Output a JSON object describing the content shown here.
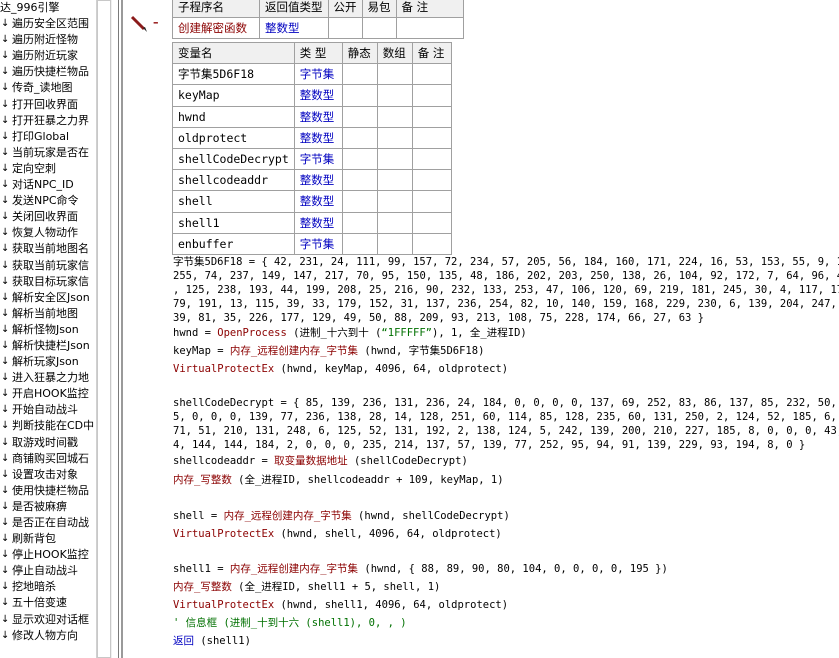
{
  "left_list": {
    "first": "达_996引擎",
    "items": [
      "遍历安全区范围",
      "遍历附近怪物",
      "遍历附近玩家",
      "遍历快捷栏物品",
      "传奇_读地图",
      "打开回收界面",
      "打开狂暴之力界",
      "打印Global",
      "当前玩家是否在",
      "定向空刺",
      "对话NPC_ID",
      "发送NPC命令",
      "关闭回收界面",
      "恢复人物动作",
      "获取当前地图名",
      "获取当前玩家信",
      "获取目标玩家信",
      "解析安全区Json",
      "解析当前地图",
      "解析怪物Json",
      "解析快捷栏Json",
      "解析玩家Json",
      "进入狂暴之力地",
      "开启HOOK监控",
      "开始自动战斗",
      "判断技能在CD中",
      "取游戏时间戳",
      "商铺购买回城石",
      "设置攻击对象",
      "使用快捷栏物品",
      "是否被麻痹",
      "是否正在自动战",
      "刷新背包",
      "停止HOOK监控",
      "停止自动战斗",
      "挖地暗杀",
      "五十倍变速",
      "显示欢迎对话框",
      "修改人物方向"
    ]
  },
  "sub_table": {
    "headers": [
      "子程序名",
      "返回值类型",
      "公开",
      "易包",
      "备 注"
    ],
    "row": [
      "创建解密函数",
      "整数型",
      "",
      "",
      ""
    ]
  },
  "var_table": {
    "headers": [
      "变量名",
      "类 型",
      "静态",
      "数组",
      "备 注"
    ],
    "rows": [
      {
        "name": "字节集5D6F18",
        "type": "字节集"
      },
      {
        "name": "keyMap",
        "type": "整数型"
      },
      {
        "name": "hwnd",
        "type": "整数型"
      },
      {
        "name": "oldprotect",
        "type": "整数型"
      },
      {
        "name": "shellCodeDecrypt",
        "type": "字节集"
      },
      {
        "name": "shellcodeaddr",
        "type": "整数型"
      },
      {
        "name": "shell",
        "type": "整数型"
      },
      {
        "name": "shell1",
        "type": "整数型"
      },
      {
        "name": "enbuffer",
        "type": "字节集"
      }
    ]
  },
  "code": {
    "l1": "字节集5D6F18 = { 42, 231, 24, 111, 99, 157, 72, 234, 57, 205, 56, 184, 160, 171, 224, 16, 53, 153, 55, 9, 192,",
    "l2": " 255, 74, 237, 149, 147, 217, 70, 95, 150, 135, 48, 186, 202, 203, 250, 138, 26, 104, 92, 172, 7, 64, 96, 41, 1",
    "l3": ", 125, 238, 193, 44, 199, 208, 25, 216, 90, 232, 133, 253, 47, 106, 120, 69, 219, 181, 245, 30, 4, 117, 176, 12",
    "l4": "79, 191, 13, 115, 39, 33, 179, 152, 31, 137, 236, 254, 82, 10, 140, 159, 168, 229, 230, 6, 139, 204, 247, 94, 2",
    "l5": "39, 81, 35, 226, 177, 129, 49, 50, 88, 209, 93, 213, 108, 75, 228, 174, 66, 27, 63 }",
    "hwnd_lhs": "hwnd = ",
    "hwnd_fn": "OpenProcess",
    "hwnd_mid": " (进制_十六到十 (",
    "hwnd_str": "“1FFFFF”",
    "hwnd_end": "), 1, 全_进程ID)",
    "keymap_lhs": "keyMap = ",
    "keymap_fn": "内存_远程创建内存_字节集",
    "keymap_args": " (hwnd, 字节集5D6F18)",
    "vpe1_fn": "VirtualProtectEx",
    "vpe1_args": " (hwnd, keyMap, 4096, 64, oldprotect)",
    "d1": "shellCodeDecrypt = { 85, 139, 236, 131, 236, 24, 184, 0, 0, 0, 0, 137, 69, 252, 83, 86, 137, 85, 232, 50, 255,",
    "d2": "5, 0, 0, 0, 139, 77, 236, 138, 28, 14, 128, 251, 60, 114, 85, 128, 235, 60, 131, 250, 2, 124, 52, 185, 6, 0, 0,",
    "d3": "71, 51, 210, 131, 248, 6, 125, 52, 131, 192, 2, 138, 124, 5, 242, 139, 200, 210, 227, 185, 8, 0, 0, 0, 43, 200,",
    "d4": "4, 144, 144, 184, 2, 0, 0, 0, 235, 214, 137, 57, 139, 77, 252, 95, 94, 91, 139, 229, 93, 194, 8, 0 }",
    "sca_lhs": "shellcodeaddr = ",
    "sca_fn": "取变量数据地址",
    "sca_args": " (shellCodeDecrypt)",
    "wi1_fn": "内存_写整数",
    "wi1_args": " (全_进程ID, shellcodeaddr + 109, keyMap, 1)",
    "shell_lhs": "shell = ",
    "shell_fn": "内存_远程创建内存_字节集",
    "shell_args": " (hwnd, shellCodeDecrypt)",
    "vpe2_fn": "VirtualProtectEx",
    "vpe2_args": " (hwnd, shell, 4096, 64, oldprotect)",
    "shell1_lhs": "shell1 = ",
    "shell1_fn": "内存_远程创建内存_字节集",
    "shell1_args": " (hwnd, { 88, 89, 90, 80, 104, 0, 0, 0, 0, 195 })",
    "wi2_fn": "内存_写整数",
    "wi2_args": " (全_进程ID, shell1 + 5, shell, 1)",
    "vpe3_fn": "VirtualProtectEx",
    "vpe3_args": " (hwnd, shell1, 4096, 64, oldprotect)",
    "comment": "' 信息框 (进制_十到十六 (shell1), 0, , )",
    "ret_fn": "返回",
    "ret_args": " (shell1)"
  },
  "colors": {
    "function": "#8b0000",
    "type": "#0000c0",
    "comment": "#007000"
  }
}
